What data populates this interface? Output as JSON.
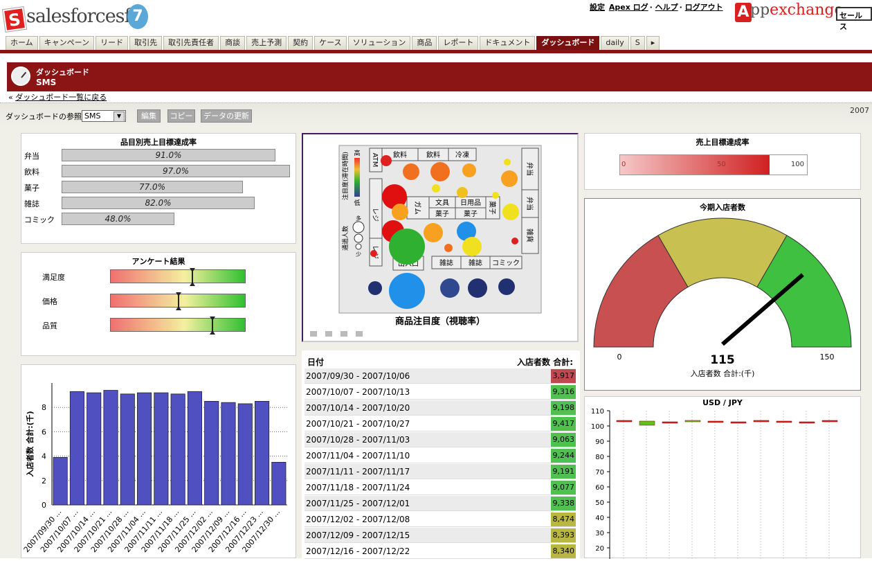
{
  "header": {
    "logo_text": "salesforcesfa",
    "logo_version": "7",
    "links": [
      "設定",
      "Apex ログ",
      "ヘルプ",
      "ログアウト"
    ],
    "appexchange": "exchange",
    "appexchange_prefix": "pp",
    "search_scope": "セールス"
  },
  "tabs": [
    "ホーム",
    "キャンペーン",
    "リード",
    "取引先",
    "取引先責任者",
    "商談",
    "売上予測",
    "契約",
    "ケース",
    "ソリューション",
    "商品",
    "レポート",
    "ドキュメント",
    "ダッシュボード",
    "daily",
    "S"
  ],
  "active_tab": "ダッシュボード",
  "page": {
    "title": "ダッシュボード",
    "subtitle": "SMS",
    "back_link": "ダッシュボード一覧に戻る",
    "back_prefix": "«",
    "view_label": "ダッシュボードの参照",
    "selected_dashboard": "SMS",
    "buttons": [
      "編集",
      "コピー",
      "データの更新"
    ],
    "date": "2007"
  },
  "achievement": {
    "title": "品目別売上目標達成率",
    "items": [
      {
        "label": "弁当",
        "value": "91.0%",
        "pct": 91.0
      },
      {
        "label": "飲料",
        "value": "97.0%",
        "pct": 97.0
      },
      {
        "label": "菓子",
        "value": "77.0%",
        "pct": 77.0
      },
      {
        "label": "雑誌",
        "value": "82.0%",
        "pct": 82.0
      },
      {
        "label": "コミック",
        "value": "48.0%",
        "pct": 48.0
      }
    ]
  },
  "survey": {
    "title": "アンケート結果",
    "items": [
      {
        "label": "満足度",
        "level": 0.6
      },
      {
        "label": "価格",
        "level": 0.5
      },
      {
        "label": "品質",
        "level": 0.75
      }
    ]
  },
  "heatmap": {
    "caption": "商品注目度（視聴率）",
    "legend_high": "高",
    "legend_low": "低",
    "legend_axis": "注目度(滞在時間)",
    "size_axis": "通過人数",
    "size_more": "多",
    "size_less": "少",
    "zones": [
      "ATM",
      "飲料",
      "飲料",
      "冷凍",
      "弁当",
      "弁当",
      "レジ",
      "ガム",
      "文具",
      "日用品",
      "菓子",
      "菓子",
      "菓子",
      "雑貨",
      "出入口",
      "雑誌",
      "雑誌",
      "コミック",
      "レジ"
    ]
  },
  "target_rate": {
    "title": "売上目標達成率",
    "ticks": [
      "0",
      "50",
      "100"
    ],
    "value": 0.8
  },
  "gauge": {
    "title": "今期入店者数",
    "value": "115",
    "min": "0",
    "max": "150",
    "caption": "入店者数 合計:(千)",
    "level": 115
  },
  "usdjpy": {
    "title": "USD / JPY",
    "yticks": [
      "110",
      "100",
      "90",
      "80",
      "70",
      "60",
      "50",
      "40",
      "30",
      "20"
    ]
  },
  "visits_table": {
    "col_date": "日付",
    "col_value": "入店者数 合計:",
    "rows": [
      {
        "date": "2007/09/30 - 2007/10/06",
        "value": "3,917",
        "color": "#c04850"
      },
      {
        "date": "2007/10/07 - 2007/10/13",
        "value": "9,316",
        "color": "#50c050"
      },
      {
        "date": "2007/10/14 - 2007/10/20",
        "value": "9,198",
        "color": "#50c050"
      },
      {
        "date": "2007/10/21 - 2007/10/27",
        "value": "9,417",
        "color": "#50c050"
      },
      {
        "date": "2007/10/28 - 2007/11/03",
        "value": "9,063",
        "color": "#50c050"
      },
      {
        "date": "2007/11/04 - 2007/11/10",
        "value": "9,244",
        "color": "#50c050"
      },
      {
        "date": "2007/11/11 - 2007/11/17",
        "value": "9,191",
        "color": "#50c050"
      },
      {
        "date": "2007/11/18 - 2007/11/24",
        "value": "9,077",
        "color": "#50c050"
      },
      {
        "date": "2007/11/25 - 2007/12/01",
        "value": "9,338",
        "color": "#50c050"
      },
      {
        "date": "2007/12/02 - 2007/12/08",
        "value": "8,474",
        "color": "#b8b840"
      },
      {
        "date": "2007/12/09 - 2007/12/15",
        "value": "8,393",
        "color": "#b8b840"
      },
      {
        "date": "2007/12/16 - 2007/12/22",
        "value": "8,340",
        "color": "#b8b840"
      }
    ]
  },
  "chart_data": {
    "type": "bar",
    "ylabel": "入店者数 合計:(千)",
    "ylim": [
      0,
      10
    ],
    "yticks": [
      "0",
      "2",
      "4",
      "6",
      "8"
    ],
    "categories": [
      "2007/09/30 ...",
      "2007/10/07 ...",
      "2007/10/14 ...",
      "2007/10/21 ...",
      "2007/10/28 ...",
      "2007/11/04 ...",
      "2007/11/11 ...",
      "2007/11/18 ...",
      "2007/11/25 ...",
      "2007/12/02 ...",
      "2007/12/09 ...",
      "2007/12/16 ...",
      "2007/12/23 ...",
      "2007/12/30 ..."
    ],
    "values": [
      3.9,
      9.3,
      9.2,
      9.4,
      9.1,
      9.2,
      9.2,
      9.1,
      9.3,
      8.5,
      8.4,
      8.3,
      8.5,
      3.5
    ],
    "bar_color": "#5050c0"
  }
}
